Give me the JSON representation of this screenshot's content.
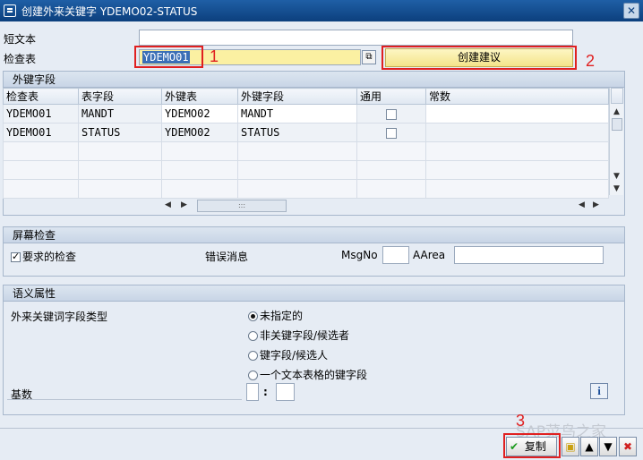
{
  "window": {
    "title": "创建外来关键字 YDEMO02-STATUS",
    "close_glyph": "✕"
  },
  "form": {
    "short_text_label": "短文本",
    "short_text_value": "",
    "check_table_label": "检查表",
    "check_table_value": "YDEMO01",
    "create_proposal_label": "创建建议"
  },
  "annotations": {
    "n1": "1",
    "n2": "2",
    "n3": "3"
  },
  "fk_fields": {
    "title": "外键字段",
    "columns": [
      "检查表",
      "表字段",
      "外键表",
      "外键字段",
      "通用",
      "常数"
    ],
    "rows": [
      {
        "check_table": "YDEMO01",
        "check_field": "MANDT",
        "fk_table": "YDEMO02",
        "fk_field": "MANDT",
        "generic": false,
        "constant": ""
      },
      {
        "check_table": "YDEMO01",
        "check_field": "STATUS",
        "fk_table": "YDEMO02",
        "fk_field": "STATUS",
        "generic": false,
        "constant": ""
      }
    ],
    "hscroll_grip": ":::"
  },
  "screen_check": {
    "title": "屏幕检查",
    "required_check_label": "要求的检查",
    "required_check_checked": true,
    "error_message_label": "错误消息",
    "msgno_label": "MsgNo",
    "msgno_value": "",
    "aarea_label": "AArea",
    "aarea_value": ""
  },
  "semantic": {
    "title": "语义属性",
    "fk_field_type_label": "外来关键词字段类型",
    "options": [
      "未指定的",
      "非关键字段/候选者",
      "键字段/候选人",
      "一个文本表格的键字段"
    ],
    "selected_index": 0,
    "cardinality_label": "基数",
    "card_left": "",
    "card_sep": ":",
    "card_right": ""
  },
  "footer": {
    "copy_label": "复制"
  },
  "watermark": "SAP菜鸟之家"
}
